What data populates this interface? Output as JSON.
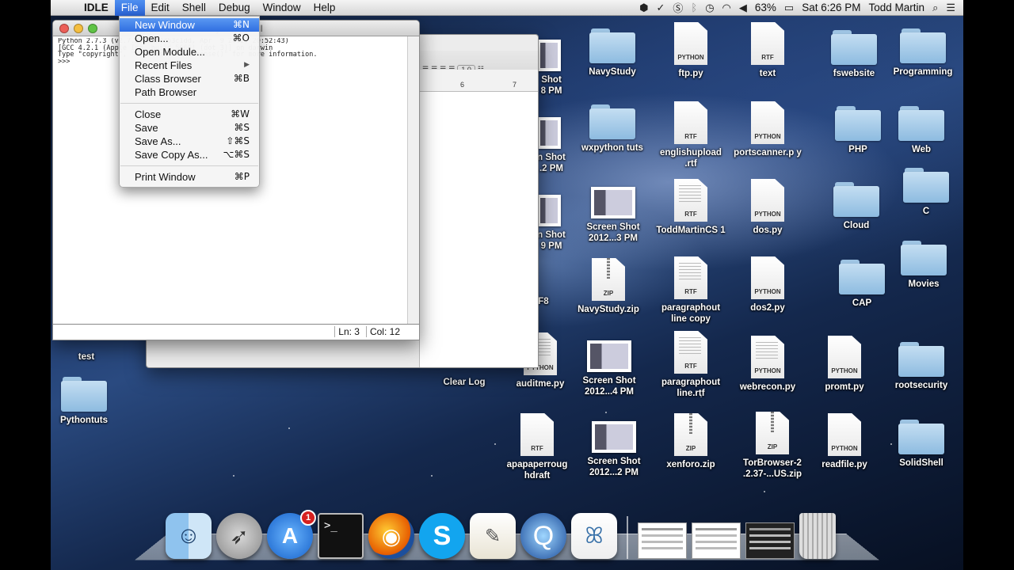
{
  "menubar": {
    "app_name": "IDLE",
    "menus": [
      "File",
      "Edit",
      "Shell",
      "Debug",
      "Window",
      "Help"
    ],
    "status": {
      "battery": "63%",
      "clock": "Sat 6:26 PM",
      "user": "Todd Martin"
    }
  },
  "file_menu": {
    "items": [
      {
        "label": "New Window",
        "shortcut": "⌘N",
        "highlighted": true
      },
      {
        "label": "Open...",
        "shortcut": "⌘O"
      },
      {
        "label": "Open Module...",
        "shortcut": ""
      },
      {
        "label": "Recent Files",
        "shortcut": "▶"
      },
      {
        "label": "Class Browser",
        "shortcut": "⌘B"
      },
      {
        "label": "Path Browser",
        "shortcut": ""
      },
      {
        "label": "Close",
        "shortcut": "⌘W"
      },
      {
        "label": "Save",
        "shortcut": "⌘S"
      },
      {
        "label": "Save As...",
        "shortcut": "⇧⌘S"
      },
      {
        "label": "Save Copy As...",
        "shortcut": "⌥⌘S"
      },
      {
        "label": "Print Window",
        "shortcut": "⌘P"
      }
    ]
  },
  "shell": {
    "title": "Python Shell",
    "lines": [
      "Python 2.7.3 (v2.7.3:70274d53c1dd, Apr  9 2012, 20:52:43)",
      "[GCC 4.2.1 (Apple Inc. build 5666) (dot 3)] on darwin",
      "Type \"copyright\", \"credits\" or \"license()\" for more information.",
      ">>> "
    ],
    "line_status": "Ln: 3",
    "col_status": "Col: 12"
  },
  "back_window": {
    "font_size": "1.0",
    "ruler_marks": [
      "6",
      "7"
    ]
  },
  "desktop": {
    "partial_labels": [
      "Shot",
      "8 PM",
      "n Shot",
      ".2 PM",
      "n Shot",
      "9 PM",
      "F8"
    ],
    "icons": {
      "test": "test",
      "pythontuts": "Pythontuts",
      "navystudy": "NavyStudy",
      "ftp": "ftp.py",
      "text": "text",
      "fswebsite": "fswebsite",
      "programming": "Programming",
      "wxpython": "wxpython tuts",
      "englishupload": "englishupload .rtf",
      "portscanner": "portscanner.p y",
      "php": "PHP",
      "web": "Web",
      "screenshot3": "Screen Shot 2012...3 PM",
      "toddmartin": "ToddMartinCS 1",
      "dos": "dos.py",
      "cloud": "Cloud",
      "c": "C",
      "navystudyzip": "NavyStudy.zip",
      "paragraphcopy": "paragraphout line copy",
      "dos2": "dos2.py",
      "cap": "CAP",
      "movies": "Movies",
      "clearlog": "Clear Log",
      "auditme": "auditme.py",
      "screenshot4": "Screen Shot 2012...4 PM",
      "paragraphrtf": "paragraphout line.rtf",
      "webrecon": "webrecon.py",
      "promt": "promt.py",
      "rootsecurity": "rootsecurity",
      "apapaper": "apapaperroug hdraft",
      "screenshot2": "Screen Shot 2012...2 PM",
      "xenforo": "xenforo.zip",
      "torbrowser": "TorBrowser-2 .2.37-...US.zip",
      "readfile": "readfile.py",
      "solidshell": "SolidShell"
    },
    "file_tags": {
      "python": "PYTHON",
      "rtf": "RTF",
      "zip": "ZIP"
    }
  },
  "dock": {
    "appstore_badge": "1",
    "terminal_prompt": ">_"
  }
}
